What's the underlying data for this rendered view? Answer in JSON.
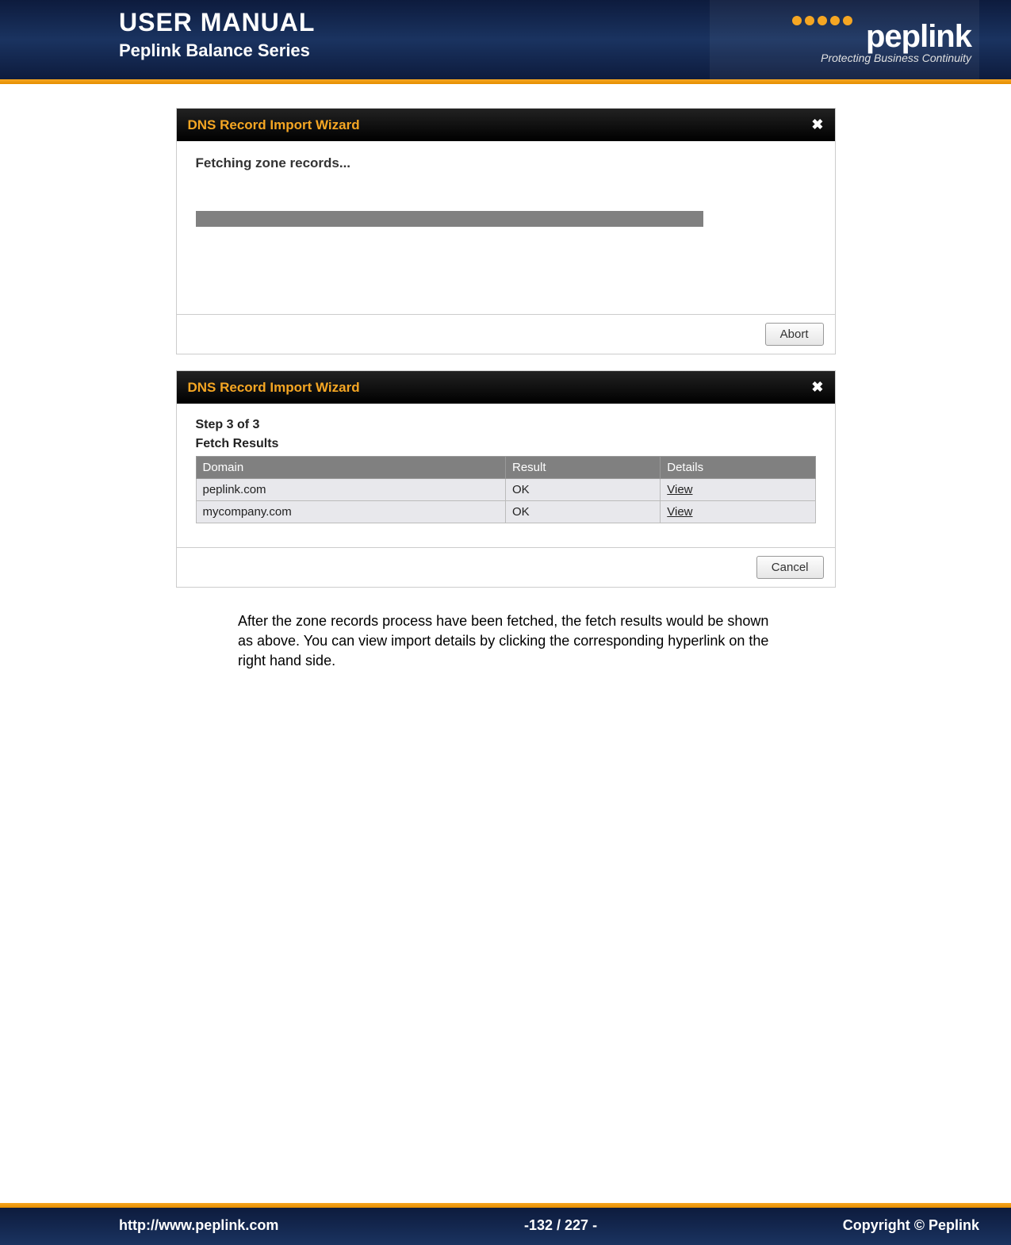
{
  "header": {
    "title": "USER MANUAL",
    "subtitle": "Peplink Balance Series",
    "logo_text": "peplink",
    "logo_tagline": "Protecting Business Continuity"
  },
  "wizard1": {
    "title": "DNS Record Import Wizard",
    "close": "✖",
    "status": "Fetching zone records...",
    "abort_label": "Abort"
  },
  "wizard2": {
    "title": "DNS Record Import Wizard",
    "close": "✖",
    "step": "Step 3 of 3",
    "section": "Fetch Results",
    "columns": {
      "domain": "Domain",
      "result": "Result",
      "details": "Details"
    },
    "rows": [
      {
        "domain": "peplink.com",
        "result": "OK",
        "details": "View"
      },
      {
        "domain": "mycompany.com",
        "result": "OK",
        "details": "View"
      }
    ],
    "cancel_label": "Cancel"
  },
  "description": "After the zone records process have been fetched, the fetch results would be shown as above. You can view import details by clicking the corresponding hyperlink on the right hand side.",
  "footer": {
    "url": "http://www.peplink.com",
    "page": "-132 / 227 -",
    "copyright": "Copyright ©  Peplink"
  }
}
